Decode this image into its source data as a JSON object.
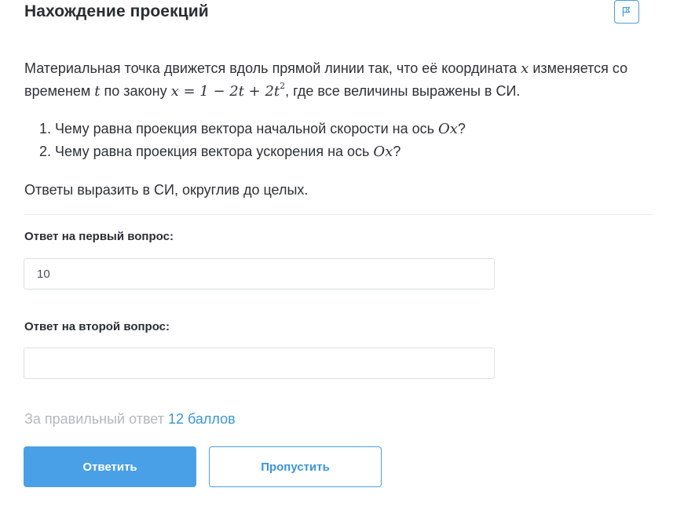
{
  "header": {
    "title": "Нахождение проекций",
    "flag_icon": "flag-icon"
  },
  "problem": {
    "text_before_x": "Материальная точка движется вдоль прямой линии так, что её координата ",
    "var_x": "x",
    "text_after_x": " изменяется со временем ",
    "var_t": "t",
    "text_law": " по закону ",
    "formula_main": "x = 1 − 2t + 2t",
    "formula_exp": "2",
    "text_end": ", где все величины выражены в СИ."
  },
  "questions": [
    {
      "num": "1.",
      "text": "Чему равна проекция вектора начальной скорости на ось ",
      "axis": "Ox",
      "end": "?"
    },
    {
      "num": "2.",
      "text": "Чему равна проекция вектора ускорения на ось ",
      "axis": "Ox",
      "end": "?"
    }
  ],
  "note": "Ответы выразить в СИ, округлив до целых.",
  "answers": {
    "first_label": "Ответ на первый вопрос:",
    "first_value": "10",
    "second_label": "Ответ на второй вопрос:",
    "second_value": ""
  },
  "reward": {
    "prefix": "За правильный ответ",
    "points": "12 баллов"
  },
  "buttons": {
    "submit": "Ответить",
    "skip": "Пропустить"
  },
  "colors": {
    "accent": "#4aa0e6",
    "link": "#3b95d8",
    "muted": "#b4b8bd"
  }
}
